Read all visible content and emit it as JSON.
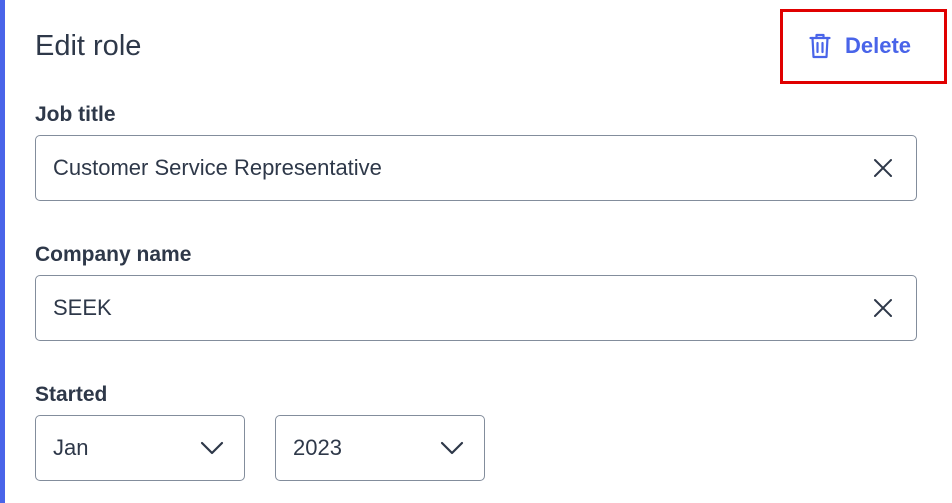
{
  "header": {
    "title": "Edit role",
    "delete_label": "Delete"
  },
  "fields": {
    "job_title": {
      "label": "Job title",
      "value": "Customer Service Representative"
    },
    "company_name": {
      "label": "Company name",
      "value": "SEEK"
    },
    "started": {
      "label": "Started",
      "month": "Jan",
      "year": "2023"
    }
  },
  "icons": {
    "delete": "trash-icon",
    "clear": "close-icon",
    "dropdown": "chevron-down-icon"
  },
  "colors": {
    "accent": "#4964e9",
    "text": "#2e3849",
    "border": "#838d9c",
    "highlight": "#e00000"
  }
}
